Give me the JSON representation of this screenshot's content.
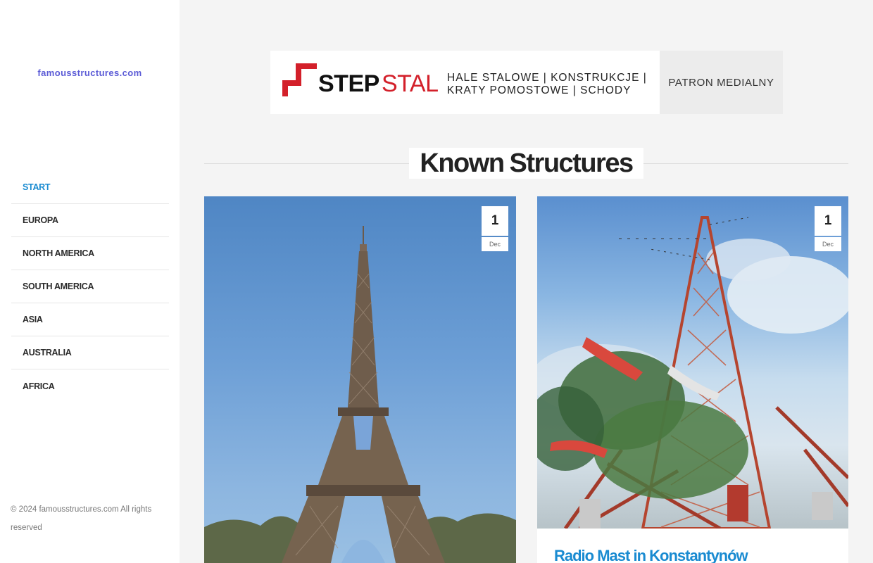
{
  "sidebar": {
    "logo": "famousstructures.com",
    "nav": [
      {
        "label": "START",
        "active": true
      },
      {
        "label": "EUROPA",
        "active": false
      },
      {
        "label": "NORTH AMERICA",
        "active": false
      },
      {
        "label": "SOUTH AMERICA",
        "active": false
      },
      {
        "label": "ASIA",
        "active": false
      },
      {
        "label": "AUSTRALIA",
        "active": false
      },
      {
        "label": "AFRICA",
        "active": false
      }
    ],
    "copyright": "© 2024 famousstructures.com All rights reserved"
  },
  "banner": {
    "brand_part1": "STEP",
    "brand_part2": "STAL",
    "line1": "HALE STALOWE | KONSTRUKCJE |",
    "line2": "KRATY POMOSTOWE | SCHODY",
    "patron": "PATRON MEDIALNY"
  },
  "section": {
    "title_light": "Known",
    "title_bold": "Structures"
  },
  "posts": [
    {
      "day": "1",
      "month": "Dec",
      "image": "eiffel-tower-photo"
    },
    {
      "day": "1",
      "month": "Dec",
      "title": "Radio Mast in Konstantynów",
      "image": "radio-mast-photo"
    }
  ],
  "colors": {
    "accent": "#1a8bd1",
    "logo": "#5b5bd6",
    "brand_red": "#d3202a"
  }
}
